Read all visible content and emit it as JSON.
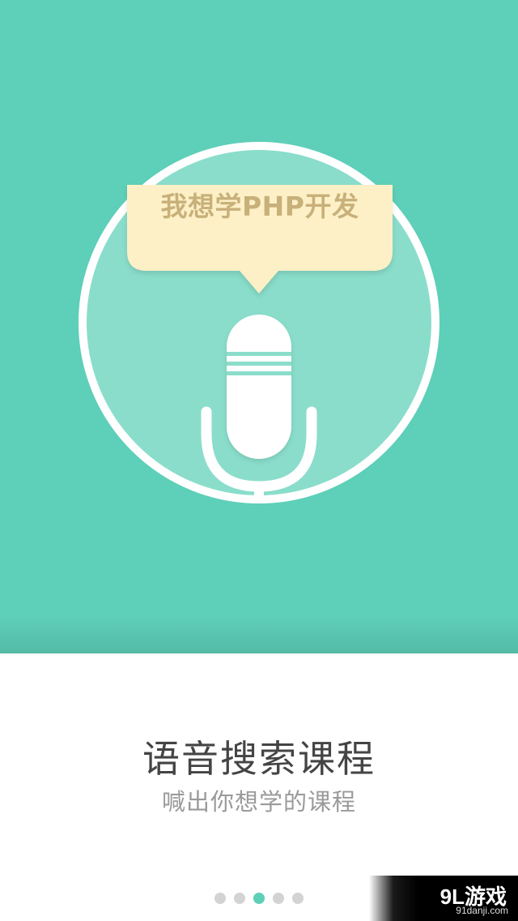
{
  "hero": {
    "bubble_text": "我想学PHP开发"
  },
  "content": {
    "title": "语音搜索课程",
    "subtitle": "喊出你想学的课程"
  },
  "pager": {
    "count": 5,
    "active_index": 2
  },
  "watermark": {
    "logo": "9L游戏",
    "url": "91danji.com"
  },
  "colors": {
    "hero_bg": "#5ecfb9",
    "circle_fill": "#8addcb",
    "bubble_fill": "#fdf0c6",
    "bubble_text": "#c8b07a",
    "title_text": "#444444",
    "subtitle_text": "#9a9a9a",
    "dot_active": "#5ecfb9",
    "dot_inactive": "#d3d3d3"
  },
  "icons": {
    "microphone": "microphone-icon",
    "speech_bubble": "speech-bubble"
  }
}
